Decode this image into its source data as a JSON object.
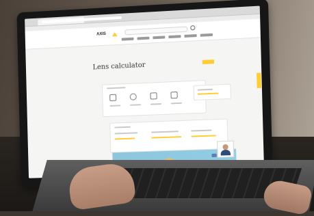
{
  "screen": {
    "brand": "AXIS",
    "page_title": "Lens calculator"
  },
  "icons": [
    "search-icon",
    "logo-triangle-icon",
    "chat-icon"
  ],
  "colors": {
    "accent": "#ffcc33",
    "screen_background": "#f4f4f2",
    "water": "#8fc9e0"
  }
}
